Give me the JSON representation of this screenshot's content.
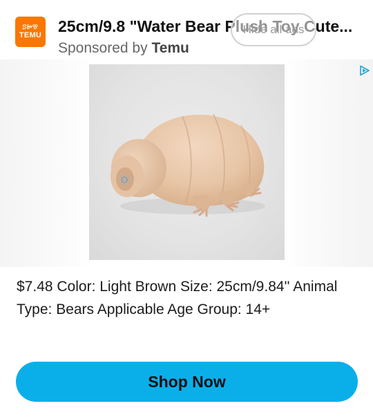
{
  "advertiser": {
    "logo_glyphs": "ꕶꔻꕢ",
    "logo_text": "TEMU",
    "brand_color": "#fb7701"
  },
  "ad": {
    "title": "25cm/9.8 \"Water Bear Plush Toy Cute...",
    "sponsored_prefix": "Sponsored by ",
    "sponsor": "Temu",
    "hide_ads_label": "Hide all ads",
    "adchoices_icon": "adchoices-triangle-icon",
    "description": "$7.48 Color: Light Brown Size: 25cm/9.84'' Animal Type: Bears Applicable Age Group: 14+",
    "cta_label": "Shop Now",
    "cta_color": "#0aafea"
  },
  "product_image": {
    "subject": "water-bear-plush-toy"
  }
}
